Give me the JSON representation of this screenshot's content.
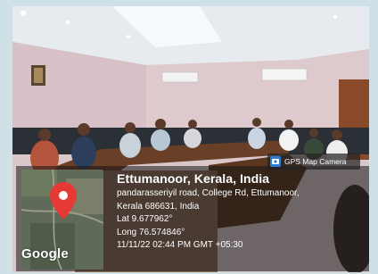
{
  "location_title": "Ettumanoor, Kerala, India",
  "address_line1": "pandarasseriyil road, College Rd, Ettumanoor,",
  "address_line2": "Kerala 686631, India",
  "latitude": "Lat 9.677962°",
  "longitude": "Long 76.574846°",
  "timestamp": "11/11/22 02:44 PM GMT +05:30",
  "app_badge": "GPS Map Camera",
  "map_logo": "Google",
  "icons": [
    "map-pin-icon",
    "gps-camera-icon"
  ],
  "colors": {
    "overlay": "#1e1e1e",
    "pin": "#e53935"
  }
}
